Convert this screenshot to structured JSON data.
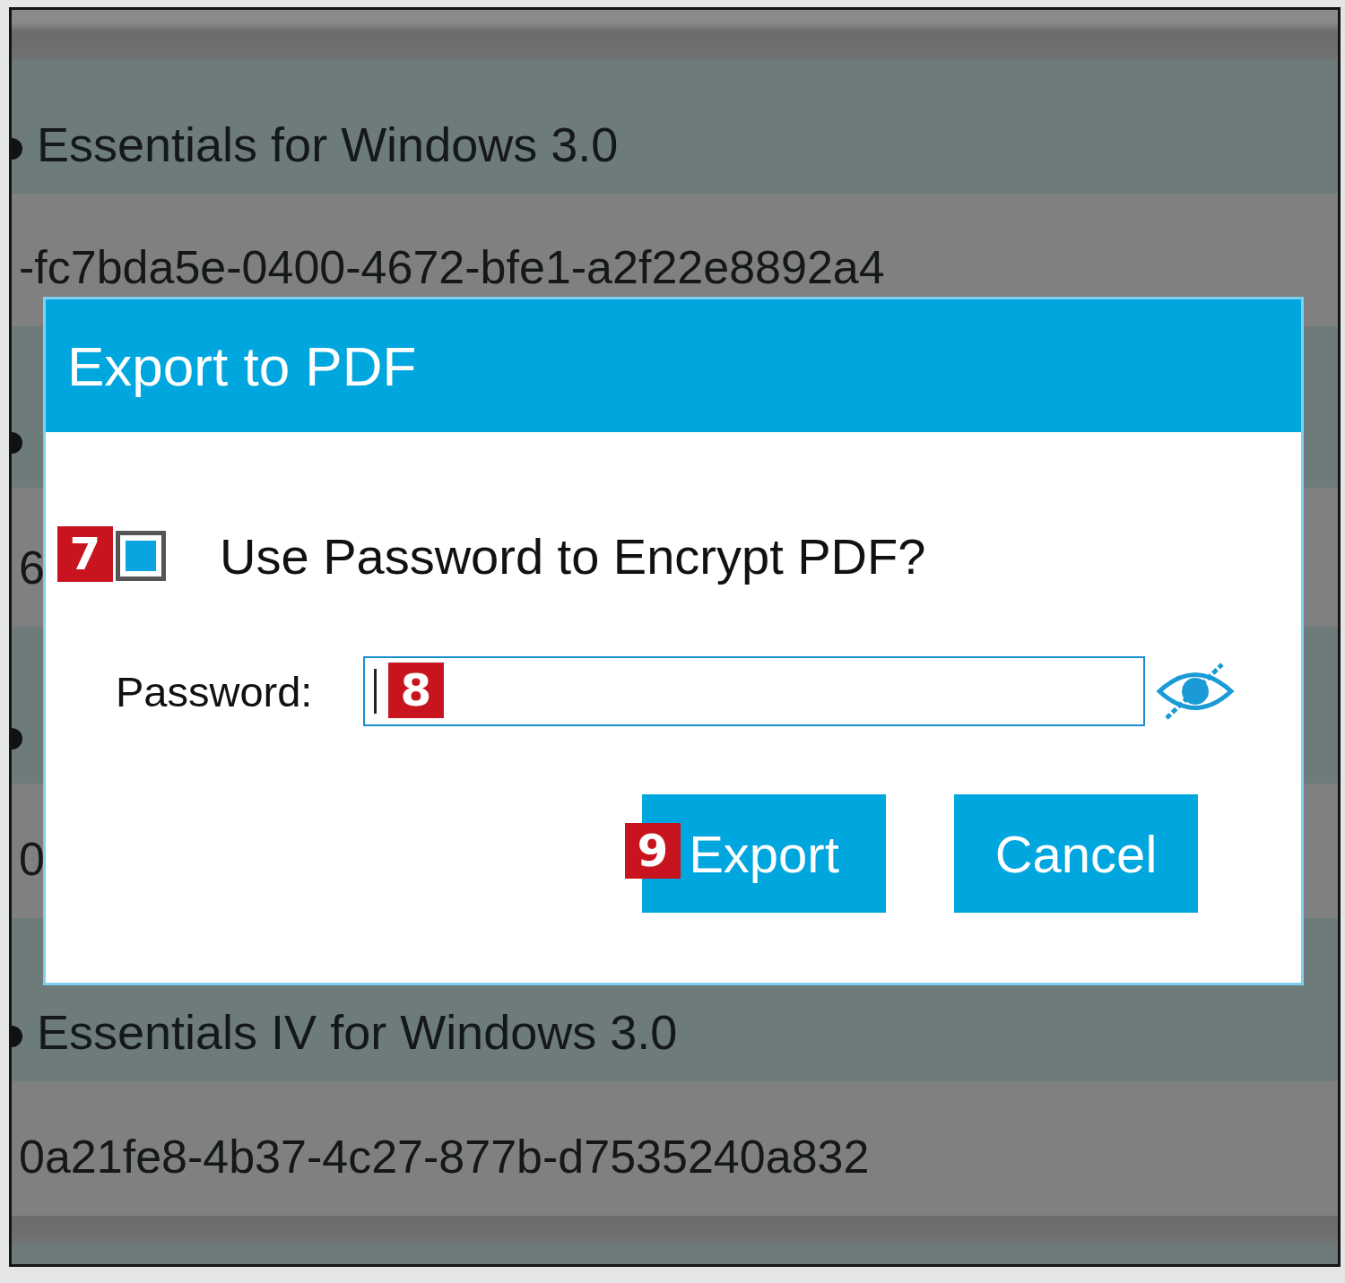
{
  "list": {
    "rows": [
      {
        "kind": "title",
        "text": "Essentials for Windows 3.0"
      },
      {
        "kind": "id",
        "text": "-fc7bda5e-0400-4672-bfe1-a2f22e8892a4"
      },
      {
        "kind": "title"
      },
      {
        "kind": "id",
        "text": "6"
      },
      {
        "kind": "title"
      },
      {
        "kind": "id",
        "text": "0"
      },
      {
        "kind": "title",
        "text": "Essentials IV for Windows 3.0"
      },
      {
        "kind": "id",
        "text": "0a21fe8-4b37-4c27-877b-d7535240a832"
      }
    ]
  },
  "dialog": {
    "title": "Export to PDF",
    "encrypt": {
      "label": "Use Password to Encrypt PDF?",
      "checked": true,
      "callout": "7"
    },
    "password": {
      "label": "Password:",
      "callout": "8"
    },
    "buttons": [
      {
        "label": "Export",
        "callout": "9"
      },
      {
        "label": "Cancel"
      }
    ]
  }
}
